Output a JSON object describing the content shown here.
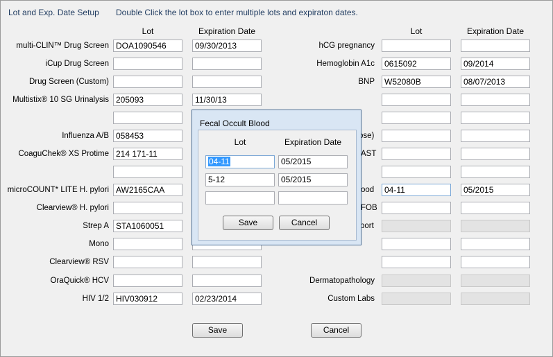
{
  "window": {
    "title": "Lot and Exp. Date Setup",
    "hint": "Double Click the lot box to enter multiple lots and expiraton  dates."
  },
  "headers": {
    "left_lot": "Lot",
    "left_exp": "Expiration Date",
    "right_lot": "Lot",
    "right_exp": "Expiration Date"
  },
  "left_rows": [
    {
      "label": "multi-CLIN™ Drug Screen",
      "lot": "DOA1090546",
      "exp": "09/30/2013"
    },
    {
      "label": "iCup Drug Screen",
      "lot": "",
      "exp": ""
    },
    {
      "label": "Drug Screen (Custom)",
      "lot": "",
      "exp": ""
    },
    {
      "label": "Multistix® 10 SG Urinalysis",
      "lot": "205093",
      "exp": "11/30/13"
    },
    {
      "label": "",
      "lot": "",
      "exp": ""
    },
    {
      "label": "Influenza A/B",
      "lot": "058453",
      "exp": ""
    },
    {
      "label": "CoaguChek® XS Protime",
      "lot": "214 171-11",
      "exp": ""
    },
    {
      "label": "",
      "lot": "",
      "exp": ""
    },
    {
      "label": "microCOUNT* LITE H. pylori",
      "lot": "AW2165CAA",
      "exp": ""
    },
    {
      "label": "Clearview® H. pylori",
      "lot": "",
      "exp": ""
    },
    {
      "label": "Strep A",
      "lot": "STA1060051",
      "exp": ""
    },
    {
      "label": "Mono",
      "lot": "",
      "exp": ""
    },
    {
      "label": "Clearview® RSV",
      "lot": "",
      "exp": ""
    },
    {
      "label": "OraQuick® HCV",
      "lot": "",
      "exp": ""
    },
    {
      "label": "HIV 1/2",
      "lot": "HIV030912",
      "exp": "02/23/2014"
    }
  ],
  "right_rows": [
    {
      "label": "hCG pregnancy",
      "lot": "",
      "exp": ""
    },
    {
      "label": "Hemoglobin A1c",
      "lot": "0615092",
      "exp": "09/2014"
    },
    {
      "label": "BNP",
      "lot": "W52080B",
      "exp": "08/07/2013"
    },
    {
      "label": "",
      "lot": "",
      "exp": ""
    },
    {
      "label": "",
      "lot": "",
      "exp": ""
    },
    {
      "label": "ose)",
      "lot": "",
      "exp": ""
    },
    {
      "label": "AST",
      "lot": "",
      "exp": ""
    },
    {
      "label": "",
      "lot": "",
      "exp": ""
    },
    {
      "label": "ood",
      "lot": "04-11",
      "exp": "05/2015"
    },
    {
      "label": "FOB",
      "lot": "",
      "exp": ""
    },
    {
      "label": "port",
      "lot": "",
      "exp": ""
    },
    {
      "label": "",
      "lot": "",
      "exp": ""
    },
    {
      "label": "",
      "lot": "",
      "exp": ""
    },
    {
      "label": "Dermatopathology",
      "lot": "",
      "exp": ""
    },
    {
      "label": "Custom Labs",
      "lot": "",
      "exp": ""
    }
  ],
  "buttons": {
    "save": "Save",
    "cancel": "Cancel"
  },
  "dialog": {
    "title": "Fecal Occult Blood",
    "col_lot": "Lot",
    "col_exp": "Expiration Date",
    "rows": [
      {
        "lot": "04-11",
        "exp": "05/2015"
      },
      {
        "lot": "5-12",
        "exp": "05/2015"
      },
      {
        "lot": "",
        "exp": ""
      }
    ],
    "save": "Save",
    "cancel": "Cancel"
  }
}
